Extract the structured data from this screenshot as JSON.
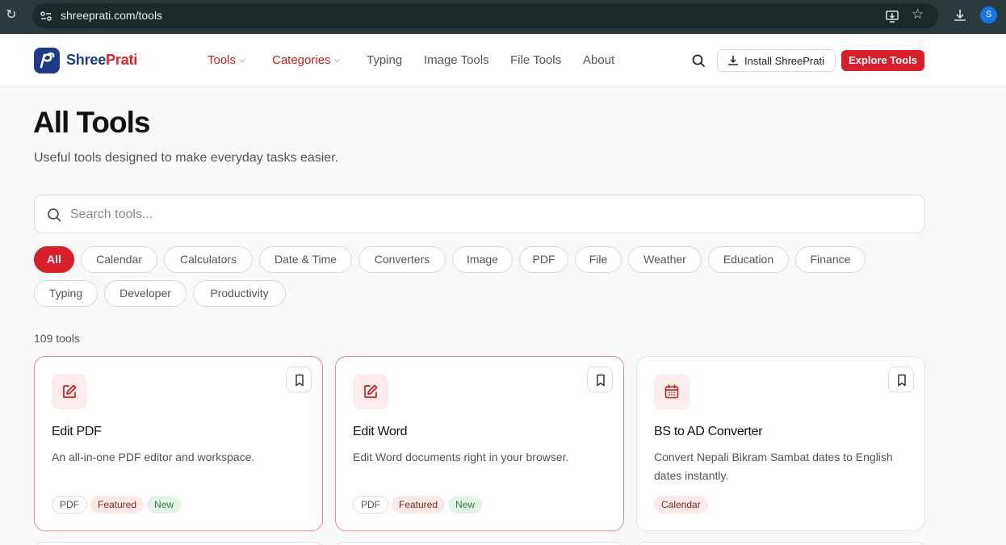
{
  "browser": {
    "url_host": "shreeprati.com",
    "url_path": "/tools",
    "profile_initial": "S"
  },
  "header": {
    "logo_part1": "Shree",
    "logo_part2": "Prati",
    "nav": {
      "tools": "Tools",
      "categories": "Categories",
      "typing": "Typing",
      "image_tools": "Image Tools",
      "file_tools": "File Tools",
      "about": "About"
    },
    "install_label": "Install ShreePrati",
    "explore_label": "Explore Tools"
  },
  "page": {
    "title": "All Tools",
    "subtitle": "Useful tools designed to make everyday tasks easier.",
    "search_placeholder": "Search tools...",
    "count_label": "109 tools"
  },
  "filters": [
    "All",
    "Calendar",
    "Calculators",
    "Date & Time",
    "Converters",
    "Image",
    "PDF",
    "File",
    "Weather",
    "Education",
    "Finance",
    "Typing",
    "Developer",
    "Productivity"
  ],
  "active_filter": "All",
  "cards": [
    {
      "icon": "edit-icon",
      "title": "Edit PDF",
      "description": "An all-in-one PDF editor and workspace.",
      "tags": [
        "PDF",
        "Featured",
        "New"
      ],
      "featured": true
    },
    {
      "icon": "edit-icon",
      "title": "Edit Word",
      "description": "Edit Word documents right in your browser.",
      "tags": [
        "PDF",
        "Featured",
        "New"
      ],
      "featured": true
    },
    {
      "icon": "calendar-icon",
      "title": "BS to AD Converter",
      "description": "Convert Nepali Bikram Sambat dates to English dates instantly.",
      "tags": [
        "Calendar"
      ],
      "featured": false
    }
  ],
  "colors": {
    "brand_red": "#d81f2a",
    "brand_navy": "#1e3a8a",
    "featured_border": "#e88a8a"
  }
}
